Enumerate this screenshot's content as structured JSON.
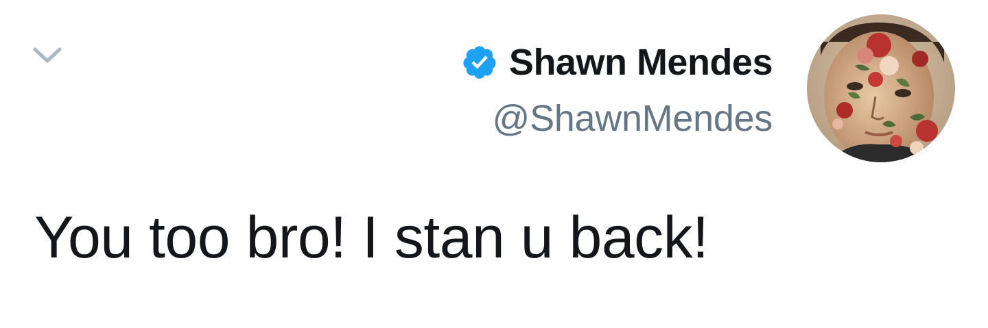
{
  "tweet": {
    "author": {
      "display_name": "Shawn Mendes",
      "handle": "@ShawnMendes",
      "verified": true,
      "verified_icon": "verified-badge-icon",
      "avatar_icon": "avatar-image"
    },
    "text": "You too bro! I stan u back!",
    "menu_icon": "chevron-down-icon"
  },
  "colors": {
    "primary_text": "#14171a",
    "secondary_text": "#657786",
    "verified_blue": "#1da1f2",
    "chevron": "#aab8c2",
    "background": "#ffffff"
  }
}
